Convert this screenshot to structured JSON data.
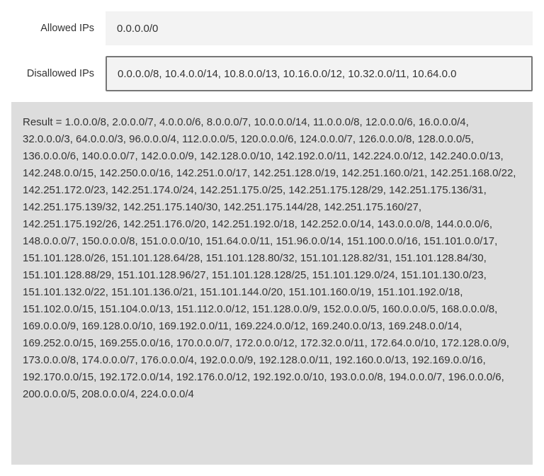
{
  "form": {
    "allowed": {
      "label": "Allowed IPs",
      "value": "0.0.0.0/0"
    },
    "disallowed": {
      "label": "Disallowed IPs",
      "value": "0.0.0.0/8, 10.4.0.0/14, 10.8.0.0/13, 10.16.0.0/12, 10.32.0.0/11, 10.64.0.0"
    }
  },
  "result": {
    "text": "Result = 1.0.0.0/8, 2.0.0.0/7, 4.0.0.0/6, 8.0.0.0/7, 10.0.0.0/14, 11.0.0.0/8, 12.0.0.0/6, 16.0.0.0/4, 32.0.0.0/3, 64.0.0.0/3, 96.0.0.0/4, 112.0.0.0/5, 120.0.0.0/6, 124.0.0.0/7, 126.0.0.0/8, 128.0.0.0/5, 136.0.0.0/6, 140.0.0.0/7, 142.0.0.0/9, 142.128.0.0/10, 142.192.0.0/11, 142.224.0.0/12, 142.240.0.0/13, 142.248.0.0/15, 142.250.0.0/16, 142.251.0.0/17, 142.251.128.0/19, 142.251.160.0/21, 142.251.168.0/22, 142.251.172.0/23, 142.251.174.0/24, 142.251.175.0/25, 142.251.175.128/29, 142.251.175.136/31, 142.251.175.139/32, 142.251.175.140/30, 142.251.175.144/28, 142.251.175.160/27, 142.251.175.192/26, 142.251.176.0/20, 142.251.192.0/18, 142.252.0.0/14, 143.0.0.0/8, 144.0.0.0/6, 148.0.0.0/7, 150.0.0.0/8, 151.0.0.0/10, 151.64.0.0/11, 151.96.0.0/14, 151.100.0.0/16, 151.101.0.0/17, 151.101.128.0/26, 151.101.128.64/28, 151.101.128.80/32, 151.101.128.82/31, 151.101.128.84/30, 151.101.128.88/29, 151.101.128.96/27, 151.101.128.128/25, 151.101.129.0/24, 151.101.130.0/23, 151.101.132.0/22, 151.101.136.0/21, 151.101.144.0/20, 151.101.160.0/19, 151.101.192.0/18, 151.102.0.0/15, 151.104.0.0/13, 151.112.0.0/12, 151.128.0.0/9, 152.0.0.0/5, 160.0.0.0/5, 168.0.0.0/8, 169.0.0.0/9, 169.128.0.0/10, 169.192.0.0/11, 169.224.0.0/12, 169.240.0.0/13, 169.248.0.0/14, 169.252.0.0/15, 169.255.0.0/16, 170.0.0.0/7, 172.0.0.0/12, 172.32.0.0/11, 172.64.0.0/10, 172.128.0.0/9, 173.0.0.0/8, 174.0.0.0/7, 176.0.0.0/4, 192.0.0.0/9, 192.128.0.0/11, 192.160.0.0/13, 192.169.0.0/16, 192.170.0.0/15, 192.172.0.0/14, 192.176.0.0/12, 192.192.0.0/10, 193.0.0.0/8, 194.0.0.0/7, 196.0.0.0/6, 200.0.0.0/5, 208.0.0.0/4, 224.0.0.0/4"
  }
}
